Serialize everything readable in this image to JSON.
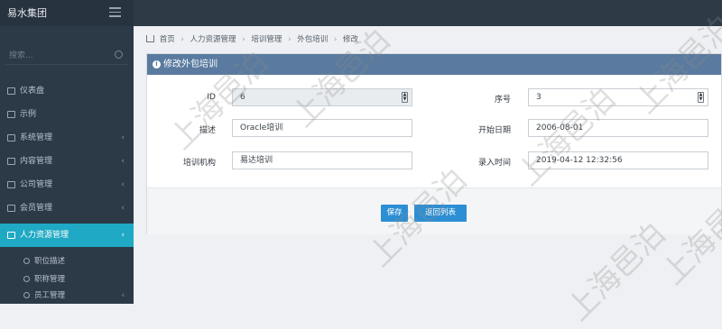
{
  "app": {
    "brand": "易水集团"
  },
  "sidebar": {
    "search_placeholder": "搜索...",
    "items": [
      {
        "label": "仪表盘",
        "icon": "home-icon",
        "chevron": ""
      },
      {
        "label": "示例",
        "icon": "globe-icon",
        "chevron": ""
      },
      {
        "label": "系统管理",
        "icon": "share-icon",
        "chevron": "‹"
      },
      {
        "label": "内容管理",
        "icon": "folder-icon",
        "chevron": "‹"
      },
      {
        "label": "公司管理",
        "icon": "sitemap-icon",
        "chevron": "‹"
      },
      {
        "label": "会员管理",
        "icon": "trophy-icon",
        "chevron": "‹"
      },
      {
        "label": "人力资源管理",
        "icon": "users-icon",
        "chevron": "‹"
      }
    ],
    "sub_items": [
      {
        "label": "职位描述",
        "icon": "diamond-icon",
        "chevron": ""
      },
      {
        "label": "职称管理",
        "icon": "headset-icon",
        "chevron": ""
      },
      {
        "label": "员工管理",
        "icon": "user-icon",
        "chevron": "‹"
      }
    ]
  },
  "breadcrumb": [
    "首页",
    "人力资源管理",
    "培训管理",
    "外包培训",
    "修改"
  ],
  "panel": {
    "title": "修改外包培训"
  },
  "form": {
    "id_label": "ID",
    "id_value": "6",
    "seq_label": "序号",
    "seq_value": "3",
    "desc_label": "描述",
    "desc_value": "Oracle培训",
    "start_label": "开始日期",
    "start_value": "2006-08-01",
    "org_label": "培训机构",
    "org_value": "易达培训",
    "entry_label": "录入时间",
    "entry_value": "2019-04-12 12:32:56"
  },
  "actions": {
    "save_label": "保存",
    "back_label": "返回列表"
  },
  "watermark": {
    "text": "上海邑泊"
  },
  "colors": {
    "sidebar_bg": "#2c3947",
    "active_item": "#1fa9c4",
    "panel_header": "#5a7b9f",
    "button": "#2d8fd3"
  }
}
